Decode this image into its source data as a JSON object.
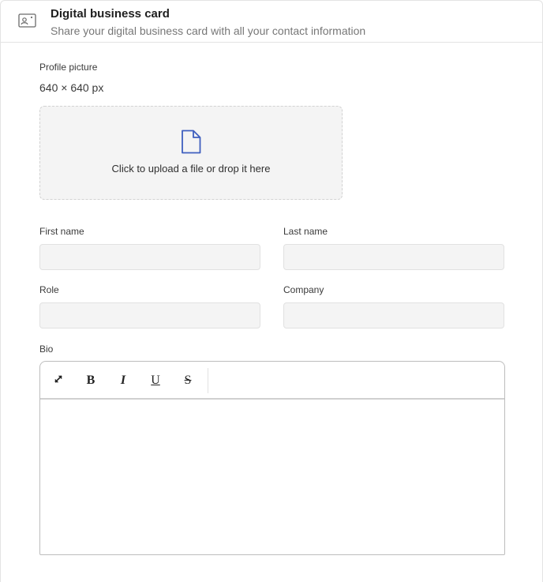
{
  "header": {
    "icon": "contact-card-icon",
    "title": "Digital business card",
    "subtitle": "Share your digital business card with all your contact information"
  },
  "profile_picture": {
    "label": "Profile picture",
    "size": "640 × 640 px",
    "dropzone_icon": "file-icon",
    "dropzone_text": "Click to upload a file or drop it here",
    "icon_color": "#3f5fbf"
  },
  "fields": {
    "first_name": {
      "label": "First name",
      "value": ""
    },
    "last_name": {
      "label": "Last name",
      "value": ""
    },
    "role": {
      "label": "Role",
      "value": ""
    },
    "company": {
      "label": "Company",
      "value": ""
    }
  },
  "bio": {
    "label": "Bio",
    "value": "",
    "toolbar": {
      "expand_icon": "expand-icon",
      "bold": "B",
      "italic": "I",
      "underline": "U",
      "strikethrough": "S"
    }
  }
}
